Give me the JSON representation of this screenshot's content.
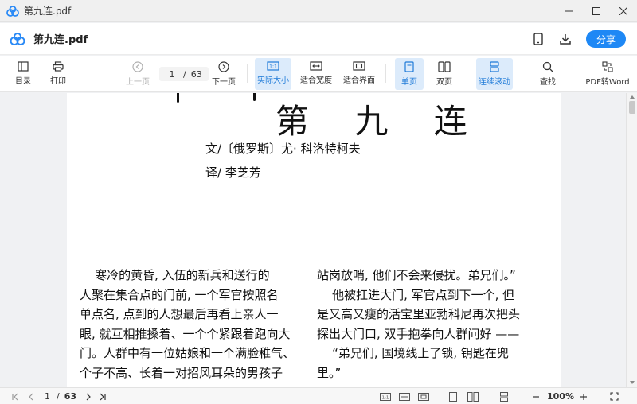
{
  "window": {
    "title": "第九连.pdf"
  },
  "header": {
    "filename": "第九连.pdf",
    "share_label": "分享"
  },
  "toolbar": {
    "toc": "目录",
    "print": "打印",
    "prev": "上一页",
    "page_current": "1",
    "page_sep": "/",
    "page_total": "63",
    "next": "下一页",
    "actual_size": "实际大小",
    "fit_width": "适合宽度",
    "fit_page": "适合界面",
    "single_page": "单页",
    "double_page": "双页",
    "continuous": "连续滚动",
    "search": "查找",
    "pdf_to_word": "PDF转Word"
  },
  "document": {
    "chapter_title": "第 九 连",
    "author": "文/〔俄罗斯〕尤· 科洛特柯夫",
    "translator": "译/ 李芝芳",
    "left_column": [
      "    寒冷的黄昏, 入伍的新兵和送行的",
      "人聚在集合点的门前, 一个军官按照名",
      "单点名, 点到的人想最后再看上亲人一",
      "眼, 就互相推搡着、一个个紧跟着跑向大",
      "门。人群中有一位姑娘和一个满脸稚气、",
      "个子不高、长着一对招风耳朵的男孩子"
    ],
    "right_column": [
      "站岗放哨, 他们不会来侵扰。弟兄们。”",
      "    他被扛进大门, 军官点到下一个, 但",
      "是又高又瘦的活宝里亚勃科尼再次把头",
      "探出大门口, 双手抱拳向人群问好 ——",
      "    “弟兄们, 国境线上了锁, 钥匙在兜",
      "里。”"
    ]
  },
  "statusbar": {
    "page_current": "1",
    "page_sep": "/",
    "page_total": "63",
    "zoom": "100%"
  },
  "colors": {
    "accent": "#1e88f5",
    "active_bg": "#dcebfb"
  }
}
